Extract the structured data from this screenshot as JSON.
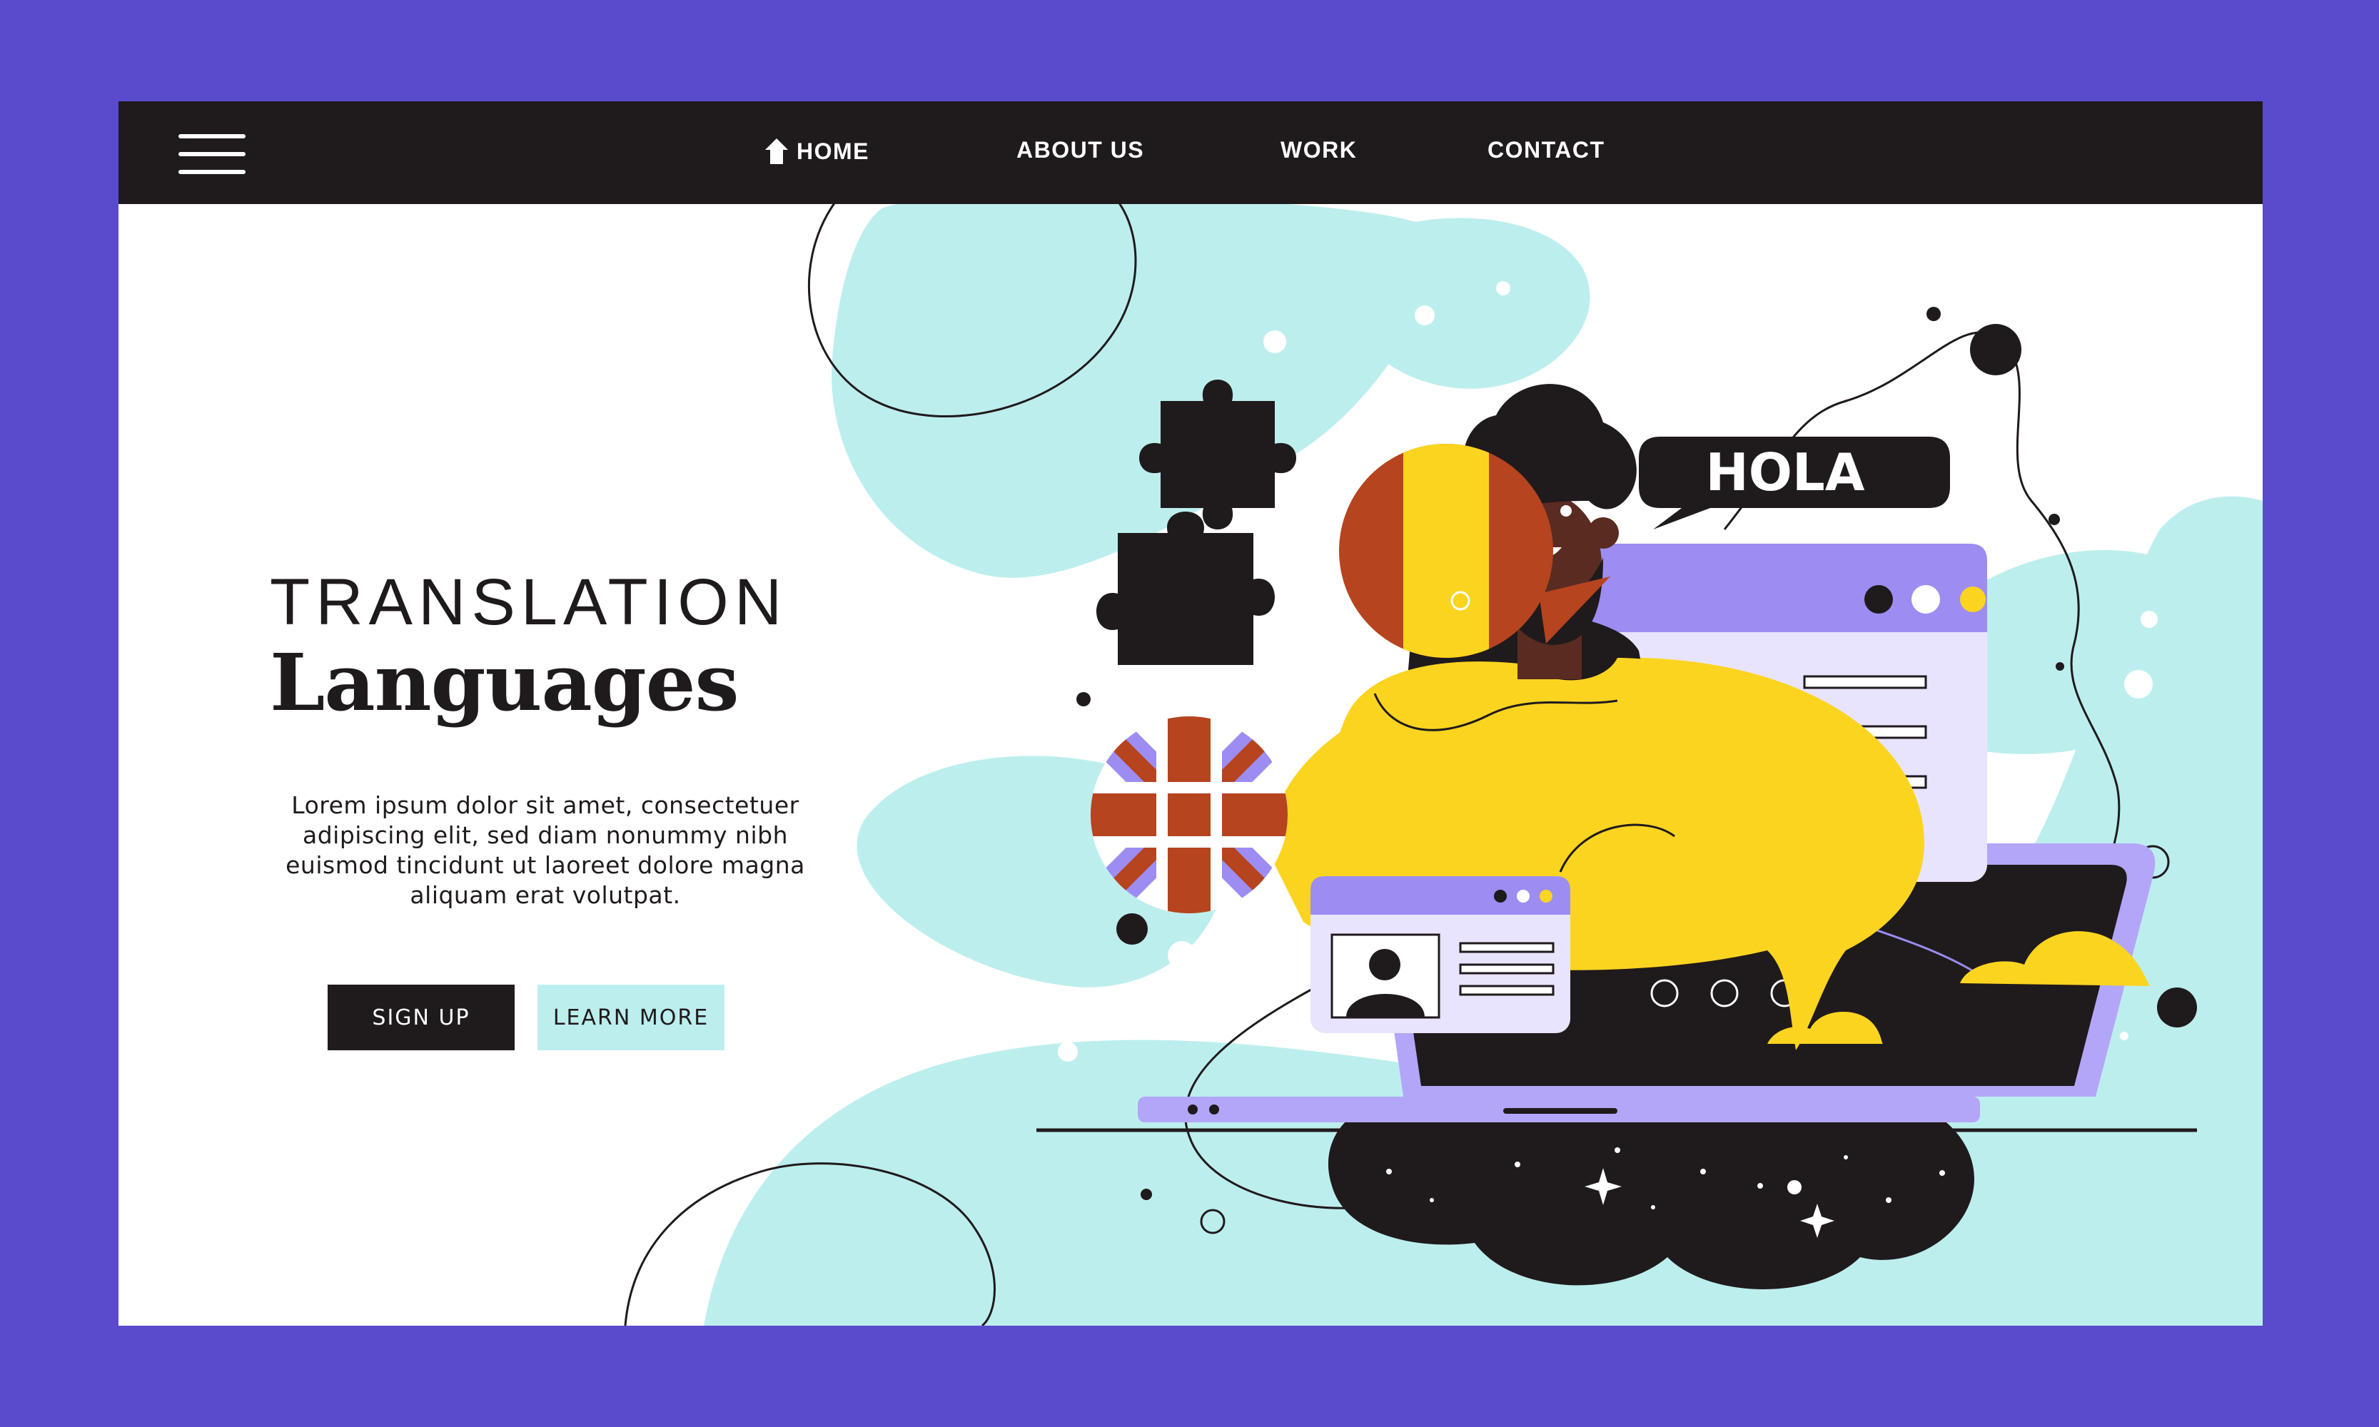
{
  "nav": {
    "home": "HOME",
    "about": "ABOUT US",
    "work": "WORK",
    "contact": "CONTACT"
  },
  "hero": {
    "title_top": "TRANSLATION",
    "title_main": "Languages",
    "body": "Lorem ipsum dolor sit amet, consectetuer adipiscing elit, sed diam nonummy nibh euismod tincidunt ut laoreet dolore magna aliquam erat volutpat.",
    "signup_label": "SIGN UP",
    "learn_label": "LEARN MORE"
  },
  "illustration": {
    "speech_bubble_text": "HOLA"
  },
  "colors": {
    "page_border": "#5a4bcc",
    "nav_bg": "#1f1a1c",
    "blob": "#bdeeee",
    "yellow": "#fbd420",
    "rust": "#b5441f",
    "lavender": "#9d8cf2",
    "dark": "#1f1a1c"
  }
}
